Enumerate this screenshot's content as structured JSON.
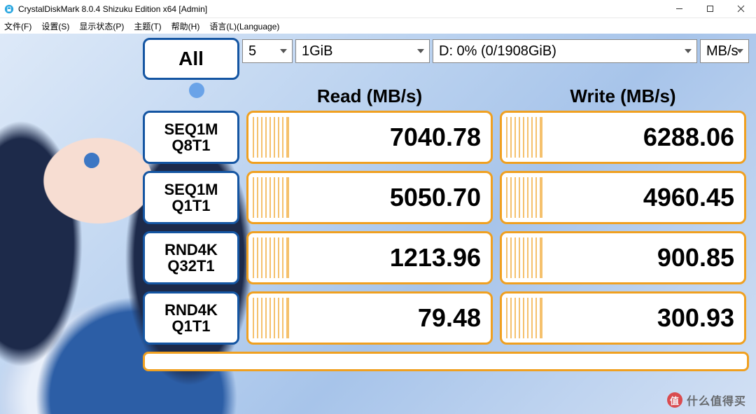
{
  "window": {
    "title": "CrystalDiskMark 8.0.4 Shizuku Edition x64 [Admin]"
  },
  "menu": {
    "items": [
      "文件(F)",
      "设置(S)",
      "显示状态(P)",
      "主题(T)",
      "帮助(H)",
      "语言(L)(Language)"
    ]
  },
  "toolbar": {
    "all_label": "All",
    "loops": "5",
    "size": "1GiB",
    "drive": "D: 0% (0/1908GiB)",
    "unit": "MB/s"
  },
  "columns": {
    "read": "Read (MB/s)",
    "write": "Write (MB/s)"
  },
  "tests": [
    {
      "line1": "SEQ1M",
      "line2": "Q8T1",
      "read": "7040.78",
      "write": "6288.06"
    },
    {
      "line1": "SEQ1M",
      "line2": "Q1T1",
      "read": "5050.70",
      "write": "4960.45"
    },
    {
      "line1": "RND4K",
      "line2": "Q32T1",
      "read": "1213.96",
      "write": "900.85"
    },
    {
      "line1": "RND4K",
      "line2": "Q1T1",
      "read": "79.48",
      "write": "300.93"
    }
  ],
  "watermark": {
    "badge": "值",
    "text": "什么值得买"
  },
  "chart_data": {
    "type": "table",
    "title": "CrystalDiskMark 8.0.4 results",
    "unit": "MB/s",
    "rows": [
      "SEQ1M Q8T1",
      "SEQ1M Q1T1",
      "RND4K Q32T1",
      "RND4K Q1T1"
    ],
    "series": [
      {
        "name": "Read",
        "values": [
          7040.78,
          5050.7,
          1213.96,
          79.48
        ]
      },
      {
        "name": "Write",
        "values": [
          6288.06,
          4960.45,
          900.85,
          300.93
        ]
      }
    ]
  }
}
